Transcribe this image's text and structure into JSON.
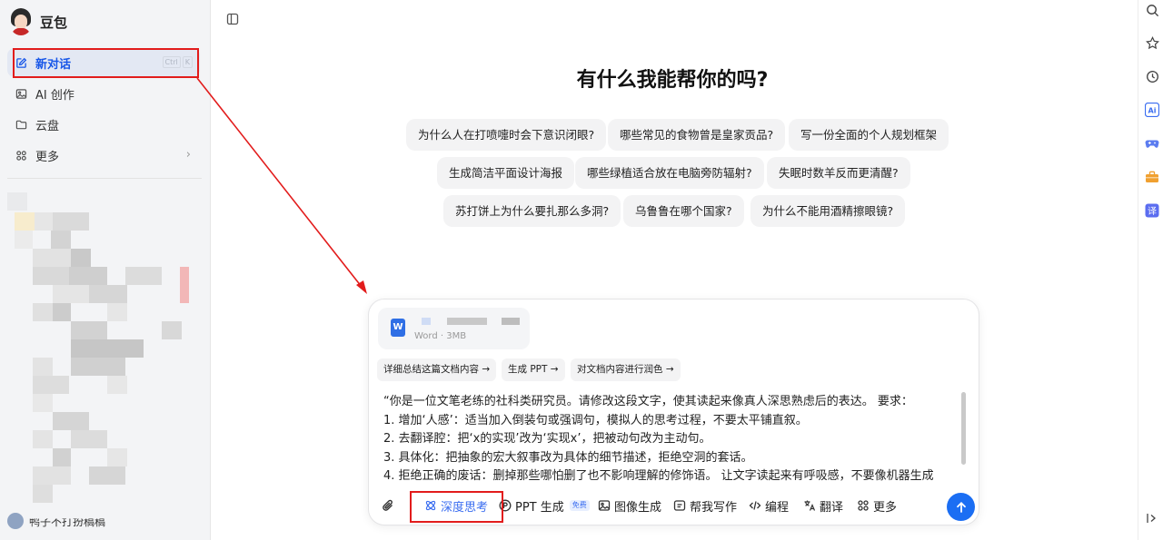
{
  "brand": {
    "name": "豆包"
  },
  "sidebar": {
    "items": [
      {
        "label": "新对话",
        "shortcut": [
          "Ctrl",
          "K"
        ]
      },
      {
        "label": "AI 创作"
      },
      {
        "label": "云盘"
      },
      {
        "label": "更多"
      }
    ],
    "user_name": "鸭子不打扮稿稿"
  },
  "main": {
    "heading": "有什么我能帮你的吗?",
    "suggestions": [
      "为什么人在打喷嚏时会下意识闭眼?",
      "哪些常见的食物曾是皇家贡品?",
      "写一份全面的个人规划框架",
      "生成简洁平面设计海报",
      "哪些绿植适合放在电脑旁防辐射?",
      "失眠时数羊反而更清醒?",
      "苏打饼上为什么要扎那么多洞?",
      "乌鲁鲁在哪个国家?",
      "为什么不能用酒精擦眼镜?"
    ]
  },
  "composer": {
    "file": {
      "type_label": "W",
      "meta": "Word · 3MB"
    },
    "actions": [
      "详细总结这篇文档内容 →",
      "生成 PPT →",
      "对文档内容进行润色 →"
    ],
    "prompt_lines": [
      "“你是一位文笔老练的社科类研究员。请修改这段文字，使其读起来像真人深思熟虑后的表达。 要求：",
      "1. 增加‘人感’：适当加入倒装句或强调句，模拟人的思考过程，不要太平铺直叙。",
      "2. 去翻译腔：把‘x的实现’改为‘实现x’，把被动句改为主动句。",
      "3. 具体化：把抽象的宏大叙事改为具体的细节描述，拒绝空洞的套话。",
      "4. 拒绝正确的废话：删掉那些哪怕删了也不影响理解的修饰语。 让文字读起来有呼吸感，不要像机器生成"
    ],
    "tools": {
      "deep_think": "深度思考",
      "ppt": "PPT 生成",
      "ppt_badge": "免费",
      "image": "图像生成",
      "write": "帮我写作",
      "code": "编程",
      "translate": "翻译",
      "more": "更多"
    }
  },
  "colors": {
    "accent": "#1b6ef3",
    "annotation": "#e21c1c",
    "active_bg": "#e3e8f3"
  },
  "right_rail": [
    "search-icon",
    "star-icon",
    "history-icon",
    "ai-icon",
    "gamepad-icon",
    "toolbox-icon",
    "translate-icon",
    "collapse-icon"
  ]
}
